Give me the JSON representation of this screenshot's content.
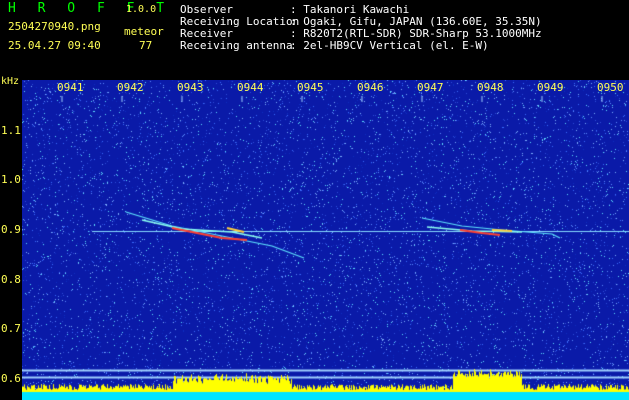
{
  "header": {
    "logo": "H R O F F T",
    "version": "1.0.0",
    "filename": "2504270940.png",
    "datetime": "25.04.27 09:40",
    "meteor_label": "meteor",
    "meteor_count": "77",
    "observer_label": "Observer",
    "observer_value": ": Takanori Kawachi",
    "location_label": "Receiving Location",
    "location_value": ": Ogaki, Gifu, JAPAN (136.60E, 35.35N)",
    "receiver_label": "Receiver",
    "receiver_value": ": R820T2(RTL-SDR) SDR-Sharp 53.1000MHz",
    "antenna_label": "Receiving antenna",
    "antenna_value": ": 2el-HB9CV Vertical (el. E-W)"
  },
  "axis": {
    "unit": "kHz",
    "y_ticks": [
      "1.1",
      "1.0",
      "0.9",
      "0.8",
      "0.7",
      "0.6"
    ],
    "x_ticks": [
      "0941",
      "0942",
      "0943",
      "0944",
      "0945",
      "0946",
      "0947",
      "0948",
      "0949",
      "0950"
    ]
  },
  "colors": {
    "background": "#0a1aa8",
    "label": "#ffff55",
    "title": "#00ff00",
    "info": "#ffffff",
    "signal_line": "#88ddff",
    "spectrum_fill": "#ffff00",
    "spectrum_base": "#00e5ff"
  }
}
